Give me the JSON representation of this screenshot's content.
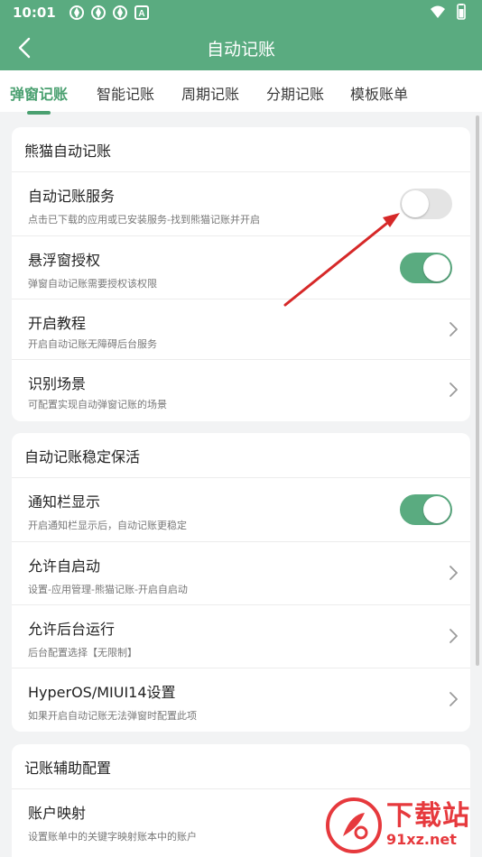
{
  "status_bar": {
    "time": "10:01",
    "badge": "A"
  },
  "navbar": {
    "title": "自动记账"
  },
  "tabs": [
    {
      "label": "弹窗记账",
      "active": true
    },
    {
      "label": "智能记账",
      "active": false
    },
    {
      "label": "周期记账",
      "active": false
    },
    {
      "label": "分期记账",
      "active": false
    },
    {
      "label": "模板账单",
      "active": false
    }
  ],
  "sections": [
    {
      "header": "熊猫自动记账",
      "rows": [
        {
          "title": "自动记账服务",
          "subtitle": "点击已下载的应用或已安装服务-找到熊猫记账并开启",
          "control": "toggle",
          "on": false
        },
        {
          "title": "悬浮窗授权",
          "subtitle": "弹窗自动记账需要授权该权限",
          "control": "toggle",
          "on": true
        },
        {
          "title": "开启教程",
          "subtitle": "开启自动记账无障碍后台服务",
          "control": "chevron"
        },
        {
          "title": "识别场景",
          "subtitle": "可配置实现自动弹窗记账的场景",
          "control": "chevron"
        }
      ]
    },
    {
      "header": "自动记账稳定保活",
      "rows": [
        {
          "title": "通知栏显示",
          "subtitle": "开启通知栏显示后，自动记账更稳定",
          "control": "toggle",
          "on": true
        },
        {
          "title": "允许自启动",
          "subtitle": "设置-应用管理-熊猫记账-开启自启动",
          "control": "chevron"
        },
        {
          "title": "允许后台运行",
          "subtitle": "后台配置选择【无限制】",
          "control": "chevron"
        },
        {
          "title": "HyperOS/MIUI14设置",
          "subtitle": "如果开启自动记账无法弹窗时配置此项",
          "control": "chevron"
        }
      ]
    },
    {
      "header": "记账辅助配置",
      "rows": [
        {
          "title": "账户映射",
          "subtitle": "设置账单中的关键字映射账本中的账户",
          "control": "none"
        }
      ]
    }
  ],
  "watermark": {
    "text": "下载站",
    "url": "91xz.net"
  },
  "colors": {
    "accent": "#5aab80",
    "tab_active": "#4aa070",
    "arrow": "#d62828",
    "watermark": "#e6393d"
  }
}
